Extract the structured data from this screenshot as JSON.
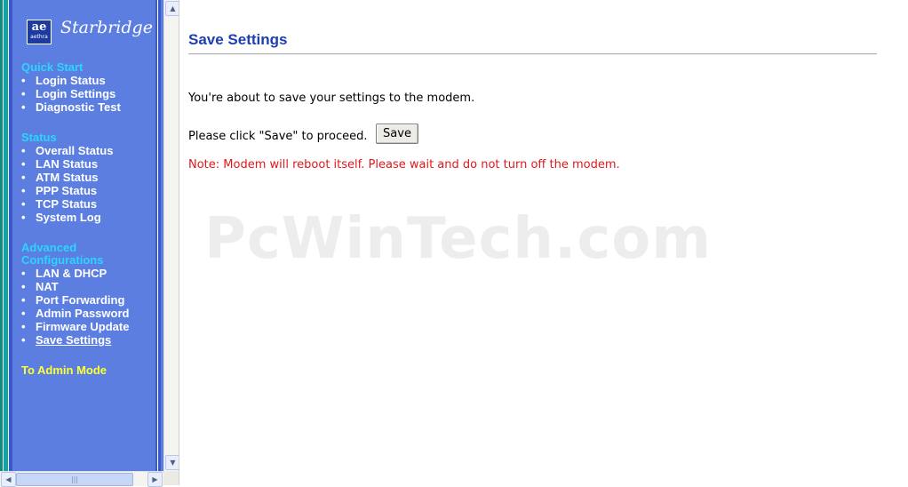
{
  "brand": {
    "logo_mark": "ae",
    "logo_sub": "aethra",
    "name": "Starbridge"
  },
  "nav": {
    "sections": [
      {
        "heading": "Quick Start",
        "items": [
          "Login Status",
          "Login Settings",
          "Diagnostic Test"
        ]
      },
      {
        "heading": "Status",
        "items": [
          "Overall Status",
          "LAN Status",
          "ATM Status",
          "PPP Status",
          "TCP Status",
          "System Log"
        ]
      },
      {
        "heading_lines": [
          "Advanced",
          "Configurations"
        ],
        "items": [
          "LAN & DHCP",
          "NAT",
          "Port Forwarding",
          "Admin Password",
          "Firmware Update",
          "Save Settings"
        ]
      }
    ],
    "active_item": "Save Settings",
    "bullet": "•",
    "admin_link": "To Admin Mode"
  },
  "scrollbar": {
    "up_arrow": "▲",
    "down_arrow": "▼",
    "left_arrow": "◀",
    "right_arrow": "▶",
    "grip": "|||"
  },
  "main": {
    "title": "Save Settings",
    "intro": "You're about to save your settings to the modem.",
    "proceed": "Please click \"Save\" to proceed.",
    "save_button": "Save",
    "note": "Note: Modem will reboot itself. Please wait and do not turn off the modem.",
    "watermark": "PcWinTech.com"
  },
  "colors": {
    "sidebar_bg": "#5c7ee0",
    "heading": "#2ad5ff",
    "admin_link": "#ffff33",
    "title": "#1d3fb3",
    "note": "#e0181c"
  }
}
